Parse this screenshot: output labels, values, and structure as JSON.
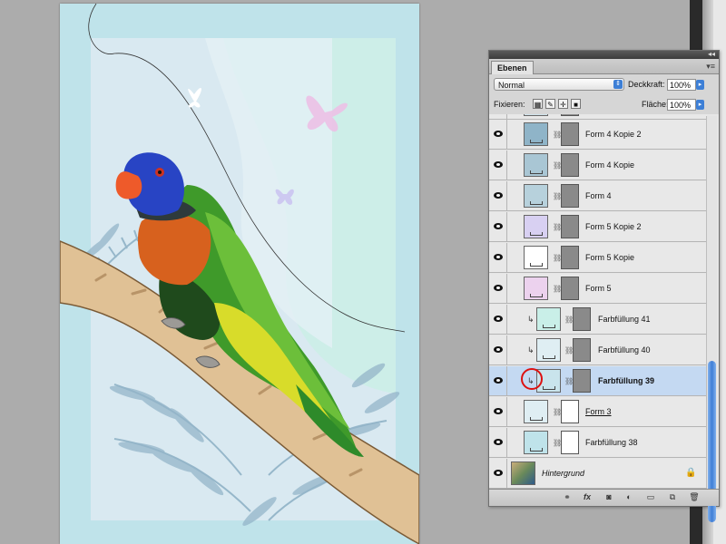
{
  "panel": {
    "tab_label": "Ebenen",
    "blend_mode": "Normal",
    "opacity_label": "Deckkraft:",
    "opacity_value": "100%",
    "lock_label": "Fixieren:",
    "fill_label": "Fläche:",
    "fill_value": "100%"
  },
  "layers": [
    {
      "name": "Form 4 Kopie 2",
      "thumb_color": "#8fb4c8",
      "clipped": false,
      "selected": false
    },
    {
      "name": "Form 4 Kopie",
      "thumb_color": "#a9c6d4",
      "clipped": false,
      "selected": false
    },
    {
      "name": "Form 4",
      "thumb_color": "#b7d1dc",
      "clipped": false,
      "selected": false
    },
    {
      "name": "Form 5 Kopie 2",
      "thumb_color": "#d8d0f2",
      "clipped": false,
      "selected": false
    },
    {
      "name": "Form 5 Kopie",
      "thumb_color": "#ffffff",
      "clipped": false,
      "selected": false
    },
    {
      "name": "Form 5",
      "thumb_color": "#ecd2ee",
      "clipped": false,
      "selected": false
    },
    {
      "name": "Farbfüllung 41",
      "thumb_color": "#c9efe8",
      "clipped": true,
      "selected": false
    },
    {
      "name": "Farbfüllung 40",
      "thumb_color": "#dfeef3",
      "clipped": true,
      "selected": false
    },
    {
      "name": "Farbfüllung 39",
      "thumb_color": "#c9e4ec",
      "clipped": true,
      "selected": true
    },
    {
      "name": "Form 3",
      "thumb_color": "#dfeef3",
      "clipped": false,
      "selected": false
    },
    {
      "name": "Farbfüllung 38",
      "thumb_color": "#bfe3ea",
      "clipped": false,
      "selected": false
    },
    {
      "name": "Hintergrund",
      "thumb_color": "#6a8a5a",
      "clipped": false,
      "selected": false
    }
  ],
  "colors": {
    "selection": "#c4d9f2",
    "accent": "#3d7fd6",
    "highlight_circle": "#d11111"
  }
}
